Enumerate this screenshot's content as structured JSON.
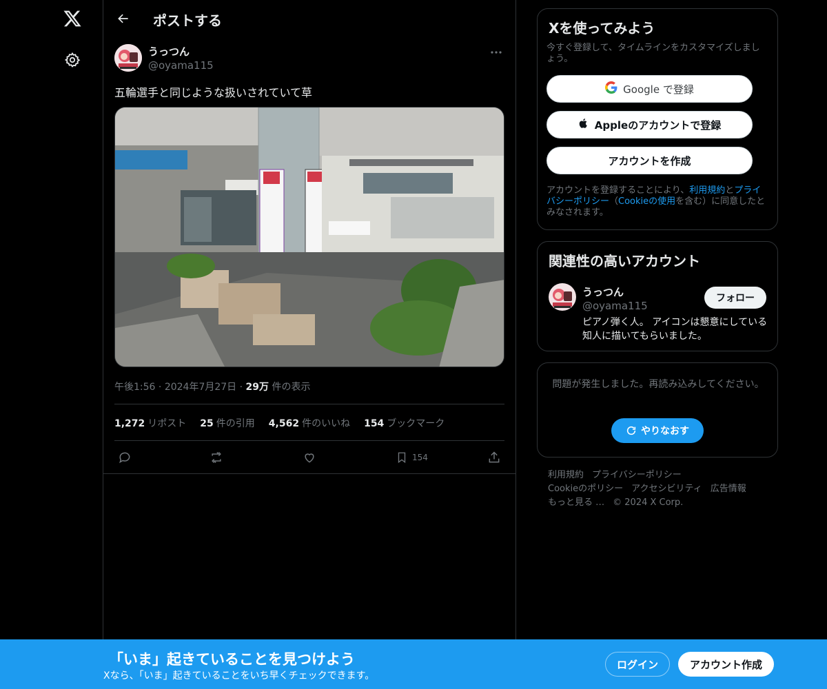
{
  "nav": {
    "logo_icon": "x-logo-icon",
    "settings_icon": "gear-icon"
  },
  "header": {
    "back_icon": "arrow-left-icon",
    "title": "ポストする"
  },
  "post": {
    "author_name": "うっつん",
    "author_handle": "@oyama115",
    "text": "五輪選手と同じような扱いされていて草",
    "image_alt": "画像",
    "image_banners": {
      "left_banner": "ラブライブ!サンシャイン!! Aqours結成9周年",
      "right_banner": "パリ2024オリンピック出場決定!! 平野美宇 高田充 西村永遠 足立聖弥"
    },
    "time": "午後1:56",
    "date": "2024年7月27日",
    "views_count": "29万",
    "views_label": "件の表示",
    "stats": {
      "reposts_count": "1,272",
      "reposts_label": "リポスト",
      "quotes_count": "25",
      "quotes_label": "件の引用",
      "likes_count": "4,562",
      "likes_label": "件のいいね",
      "bookmarks_count": "154",
      "bookmarks_label": "ブックマーク"
    },
    "actions": {
      "reply_icon": "reply-icon",
      "repost_icon": "repost-icon",
      "like_icon": "heart-icon",
      "bookmark_icon": "bookmark-icon",
      "bookmark_count": "154",
      "share_icon": "share-icon"
    }
  },
  "signup_card": {
    "title": "Xを使ってみよう",
    "subtitle": "今すぐ登録して、タイムラインをカスタマイズしましょう。",
    "google_label": "Google で登録",
    "apple_label": "Appleのアカウントで登録",
    "create_label": "アカウントを作成",
    "terms_prefix": "アカウントを登録することにより、",
    "terms_link": "利用規約",
    "terms_and": "と",
    "privacy_link": "プライバシーポリシー",
    "cookie_open": "（",
    "cookie_link": "Cookieの使用",
    "terms_suffix": "を含む）に同意したとみなされます。"
  },
  "relevant_card": {
    "title": "関連性の高いアカウント",
    "name": "うっつん",
    "handle": "@oyama115",
    "bio": "ピアノ弾く人。 アイコンは懇意にしている知人に描いてもらいました。",
    "follow_label": "フォロー"
  },
  "error_card": {
    "message": "問題が発生しました。再読み込みしてください。",
    "retry_label": "やりなおす"
  },
  "footer": {
    "terms": "利用規約",
    "privacy": "プライバシーポリシー",
    "cookie": "Cookieのポリシー",
    "accessibility": "アクセシビリティ",
    "ads": "広告情報",
    "more": "もっと見る …",
    "copyright": "© 2024 X Corp."
  },
  "bottom_bar": {
    "title": "「いま」起きていることを見つけよう",
    "subtitle": "Xなら、「いま」起きていることをいち早くチェックできます。",
    "login_label": "ログイン",
    "signup_label": "アカウント作成"
  },
  "colors": {
    "accent": "#1d9bf0",
    "background": "#000000",
    "border": "#2f3336",
    "text_primary": "#e7e9ea",
    "text_secondary": "#71767b"
  }
}
